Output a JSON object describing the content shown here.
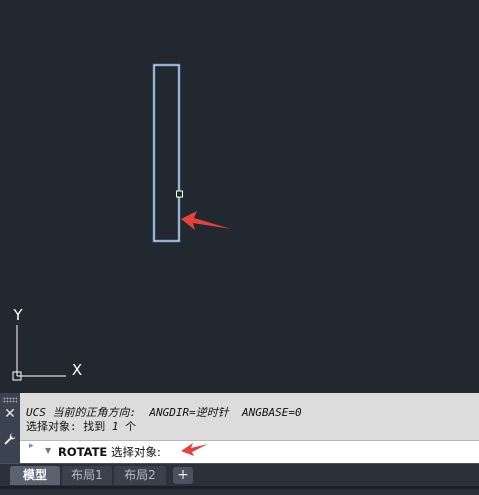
{
  "canvas": {
    "ucs": {
      "x_label": "X",
      "y_label": "Y"
    },
    "colors": {
      "background": "#212830",
      "rectangle": "#d7ecff",
      "grip": "#ffffff",
      "arrow": "#e8403c"
    }
  },
  "command_line": {
    "history": [
      {
        "prefix": "UCS 当前的正角方向:",
        "part1": "ANGDIR=逆时针",
        "part2": "ANGBASE=0"
      },
      {
        "text_a": "选择对象: 找到 ",
        "count": "1",
        "text_b": " 个"
      }
    ],
    "input": {
      "command": "ROTATE",
      "prompt": "选择对象:"
    },
    "icons": {
      "close": "close-icon",
      "customize": "wrench-icon"
    }
  },
  "layout_tabs": {
    "tabs": [
      "模型",
      "布局1",
      "布局2"
    ],
    "active": "模型",
    "add_label": "+"
  }
}
